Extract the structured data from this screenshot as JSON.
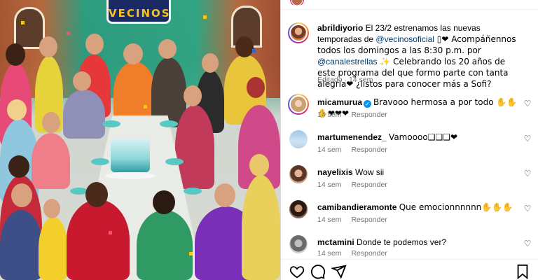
{
  "post": {
    "caption_user": "abrildiyorio",
    "caption_part1": " El 23/2 estrenamos las nuevas temporadas de ",
    "mention1": "@vecinosoficial",
    "caption_part2": " ▯❤ Acompáñennos todos los domingos a las 8:30 p.m. por ",
    "mention2": "@canalestrellas",
    "caption_part3": " ✨ Celebrando los 20 años de este programa del que formo parte con tanta alegria❤ ¿listos para conocer más a Sofi?",
    "edited_label": "Editado",
    "edited_time": "14 sem",
    "media_logo": "VECINOS"
  },
  "comments": [
    {
      "user": "micamurua",
      "verified": true,
      "text": "Bravooo hermosa a por todo ✋✋✋❤❤❤",
      "time": "14 sem",
      "reply": "Responder"
    },
    {
      "user": "martumenendez_",
      "verified": false,
      "text": "Vamoooo❑❑❑❤",
      "time": "14 sem",
      "reply": "Responder"
    },
    {
      "user": "nayelixis",
      "verified": false,
      "text": "Wow sii",
      "time": "14 sem",
      "reply": "Responder"
    },
    {
      "user": "camibandieramonte",
      "verified": false,
      "text": "Que emocionnnnnn✋✋✋",
      "time": "14 sem",
      "reply": "Responder"
    },
    {
      "user": "mctamini",
      "verified": false,
      "text": "Donde te podemos ver?",
      "time": "14 sem",
      "reply": "Responder"
    }
  ],
  "icons": {
    "like": "heart-icon",
    "comment": "comment-bubble-icon",
    "share": "paper-plane-icon",
    "save": "bookmark-icon"
  },
  "colors": {
    "mention": "#00376b",
    "meta": "#737373",
    "verified": "#0095f6"
  }
}
